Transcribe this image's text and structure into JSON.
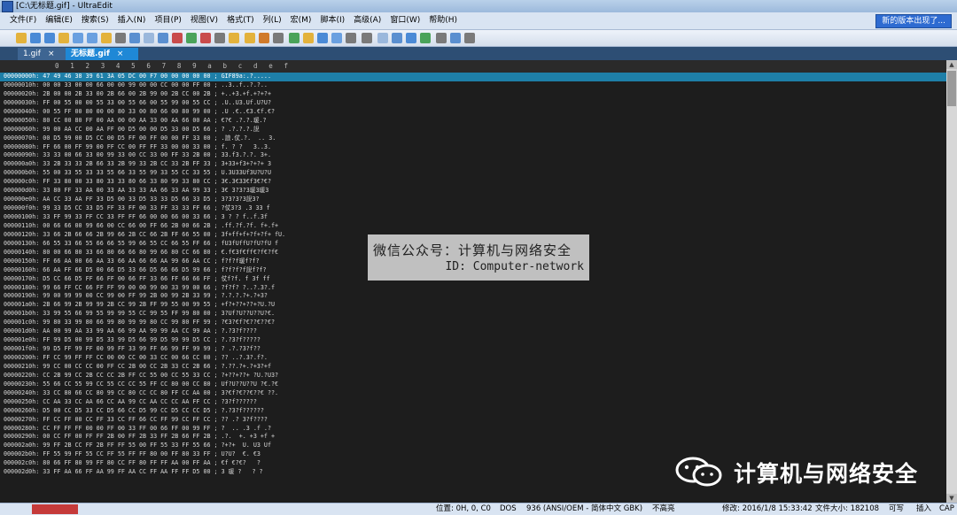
{
  "window": {
    "title": "[C:\\无标题.gif] - UltraEdit"
  },
  "menu": {
    "items": [
      "文件(F)",
      "编辑(E)",
      "搜索(S)",
      "插入(N)",
      "项目(P)",
      "视图(V)",
      "格式(T)",
      "列(L)",
      "宏(M)",
      "脚本(I)",
      "高级(A)",
      "窗口(W)",
      "帮助(H)"
    ],
    "notice": "新的版本出现了..."
  },
  "tabs": [
    {
      "label": "1.gif",
      "close": "×"
    },
    {
      "label": "无标题.gif",
      "close": "×"
    }
  ],
  "ruler": "0 1 2 3 4 5 6 7 8 9 a b c d e f",
  "hex_rows": [
    "00000000h: 47 49 46 38 39 61 3A 05 DC 00 F7 00 00 00 00 00 ; GIF89a:.?.....",
    "00000010h: 00 00 33 00 00 66 00 00 99 00 00 CC 00 00 FF 00 ; ..3..f..?.?..",
    "00000020h: 2B 00 00 2B 33 00 2B 66 00 2B 99 00 2B CC 00 2B ; +..+3.+f.+?+?+",
    "00000030h: FF 00 55 00 00 55 33 00 55 66 00 55 99 00 55 CC ; .U..U3.Uf.U?U?",
    "00000040h: 00 55 FF 00 80 00 00 80 33 00 80 66 00 80 99 00 ; .U .€..€3.€f.€?",
    "00000050h: 80 CC 00 80 FF 00 AA 00 00 AA 33 00 AA 66 00 AA ; €?€ .?.?.瑗.?",
    "00000060h: 99 00 AA CC 00 AA FF 00 D5 00 00 D5 33 00 D5 66 ; ? .?.?.?.誽",
    "00000070h: 00 D5 99 00 D5 CC 00 D5 FF 00 FF 00 00 FF 33 00 ; .誏.仗.?.  .. 3.",
    "00000080h: FF 66 00 FF 99 00 FF CC 00 FF FF 33 00 00 33 00 ; f. ? ?   3..3.",
    "00000090h: 33 33 00 66 33 00 99 33 00 CC 33 00 FF 33 2B 00 ; 33.f3.?.?. 3+.",
    "000000a0h: 33 2B 33 33 2B 66 33 2B 99 33 2B CC 33 2B FF 33 ; 3+33+f3+?+?+ 3",
    "000000b0h: 55 00 33 55 33 33 55 66 33 55 99 33 55 CC 33 55 ; U.3U33Uf3U?U?U",
    "000000c0h: FF 33 80 00 33 80 33 33 80 66 33 80 99 33 80 CC ; 3€.3€33€f3€?€?",
    "000000d0h: 33 80 FF 33 AA 00 33 AA 33 33 AA 66 33 AA 99 33 ; 3€ 3?3?3瑗3瑗3",
    "000000e0h: AA CC 33 AA FF 33 D5 00 33 D5 33 33 D5 66 33 D5 ; 3?3?3?3誽3?",
    "000000f0h: 99 33 D5 CC 33 D5 FF 33 FF 00 33 FF 33 33 FF 66 ; ?仗3?3 .3 33 f",
    "00000100h: 33 FF 99 33 FF CC 33 FF FF 66 00 00 66 00 33 66 ; 3 ? ? f..f.3f",
    "00000110h: 00 66 66 00 99 66 00 CC 66 00 FF 66 2B 00 66 2B ; .ff.?f.?f. f+.f+",
    "00000120h: 33 66 2B 66 66 2B 99 66 2B CC 66 2B FF 66 55 00 ; 3f+ff+f+?f+?f+ fU.",
    "00000130h: 66 55 33 66 55 66 66 55 99 66 55 CC 66 55 FF 66 ; fU3fUffU?fU?fU f",
    "00000140h: 80 00 66 80 33 66 80 66 66 80 99 66 80 CC 66 80 ; €.f€3f€ff€?f€?f€",
    "00000150h: FF 66 AA 00 66 AA 33 66 AA 66 66 AA 99 66 AA CC ; f?f?f瑗f?f?",
    "00000160h: 66 AA FF 66 D5 00 66 D5 33 66 D5 66 66 D5 99 66 ; f?f?f?f誽f?f?",
    "00000170h: D5 CC 66 D5 FF 66 FF 00 66 FF 33 66 FF 66 66 FF ; 仗f?f. f 3f ff",
    "00000180h: 99 66 FF CC 66 FF FF 99 00 00 99 00 33 99 00 66 ; ?f?f? ?..?.3?.f",
    "00000190h: 99 00 99 99 00 CC 99 00 FF 99 2B 00 99 2B 33 99 ; ?.?.?.?+.?+3?",
    "000001a0h: 2B 66 99 2B 99 99 2B CC 99 2B FF 99 55 00 99 55 ; +f?+??+??+?U.?U",
    "000001b0h: 33 99 55 66 99 55 99 99 55 CC 99 55 FF 99 80 00 ; 3?Uf?U??U??U?€.",
    "000001c0h: 99 80 33 99 80 66 99 80 99 99 80 CC 99 80 FF 99 ; ?€3?€f?€??€??€?",
    "000001d0h: AA 00 99 AA 33 99 AA 66 99 AA 99 99 AA CC 99 AA ; ?.?3?f????",
    "000001e0h: FF 99 D5 00 99 D5 33 99 D5 66 99 D5 99 99 D5 CC ; ?.?3?f?????",
    "000001f0h: 99 D5 FF 99 FF 00 99 FF 33 99 FF 66 99 FF 99 99 ; ? .?.?3?f??",
    "00000200h: FF CC 99 FF FF CC 00 00 CC 00 33 CC 00 66 CC 00 ; ?? ..?.3?.f?.",
    "00000210h: 99 CC 00 CC CC 00 FF CC 2B 00 CC 2B 33 CC 2B 66 ; ?.??.?+.?+3?+f",
    "00000220h: CC 2B 99 CC 2B CC CC 2B FF CC 55 00 CC 55 33 CC ; ?+??+??+ ?U.?U3?",
    "00000230h: 55 66 CC 55 99 CC 55 CC CC 55 FF CC 80 00 CC 80 ; Uf?U??U??U ?€.?€",
    "00000240h: 33 CC 80 66 CC 80 99 CC 80 CC CC 80 FF CC AA 00 ; 3?€f?€??€??€ ??.",
    "00000250h: CC AA 33 CC AA 66 CC AA 99 CC AA CC CC AA FF CC ; ?3?f??????",
    "00000260h: D5 00 CC D5 33 CC D5 66 CC D5 99 CC D5 CC CC D5 ; ?.?3?f??????",
    "00000270h: FF CC FF 00 CC FF 33 CC FF 66 CC FF 99 CC FF CC ; ?? .? 3?f????",
    "00000280h: CC FF FF FF 00 00 FF 00 33 FF 00 66 FF 00 99 FF ; ?  .. .3 .f .?",
    "00000290h: 00 CC FF 00 FF FF 2B 00 FF 2B 33 FF 2B 66 FF 2B ; .?.  +. +3 +f +",
    "000002a0h: 99 FF 2B CC FF 2B FF FF 55 00 FF 55 33 FF 55 66 ; ?+?+  U. U3 Uf",
    "000002b0h: FF 55 99 FF 55 CC FF 55 FF FF 80 00 FF 80 33 FF ; U?U?  €. €3",
    "000002c0h: 80 66 FF 80 99 FF 80 CC FF 80 FF FF AA 00 FF AA ; €f €?€?   ?",
    "000002d0h: 33 FF AA 66 FF AA 99 FF AA CC FF AA FF FF D5 00 ; 3 瑗 ?   ? ?"
  ],
  "overlay": {
    "line1": "微信公众号：计算机与网络安全",
    "line2": "ID: Computer-network"
  },
  "watermark": {
    "text": "计算机与网络安全",
    "icon": "wechat-logo-icon"
  },
  "status": {
    "position": "位置: 0H, 0, C0",
    "line_ending": "DOS",
    "codepage": "936  (ANSI/OEM - 简体中文 GBK)",
    "highlight": "不高亮",
    "modified": "修改: 2016/1/8 15:33:42",
    "filesize": "文件大小: 182108",
    "rw": "可写",
    "insert": "插入",
    "cap": "CAP"
  },
  "colors": {
    "selection": "#1e7fa8",
    "tab_active": "#1f88d6",
    "editor_bg": "#1d1d1d"
  }
}
